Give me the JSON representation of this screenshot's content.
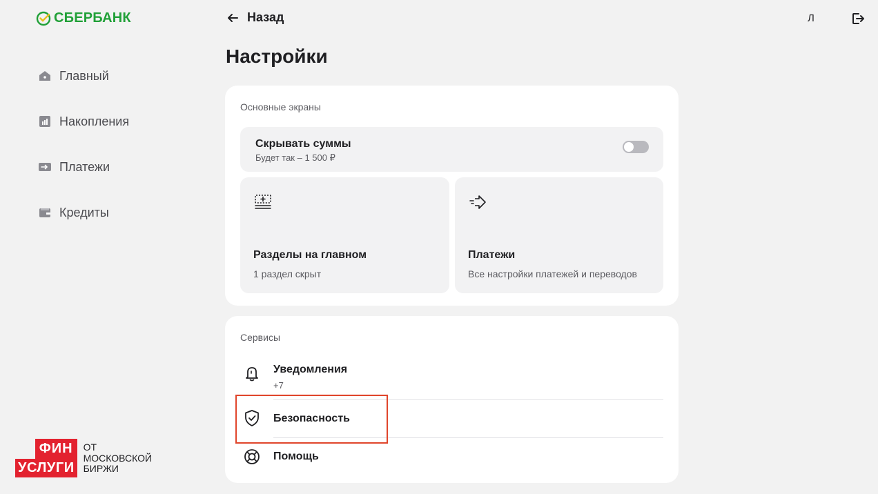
{
  "brand": {
    "name": "СБЕРБАНК",
    "color": "#21a038"
  },
  "sidebar": {
    "items": [
      {
        "label": "Главный",
        "icon": "home-icon"
      },
      {
        "label": "Накопления",
        "icon": "chart-icon"
      },
      {
        "label": "Платежи",
        "icon": "transfer-icon"
      },
      {
        "label": "Кредиты",
        "icon": "wallet-icon"
      }
    ]
  },
  "header": {
    "back_label": "Назад",
    "user_initial": "Л",
    "logout_icon": "logout-icon"
  },
  "page": {
    "title": "Настройки"
  },
  "main_screens": {
    "title": "Основные экраны",
    "hide_amounts": {
      "label": "Скрывать суммы",
      "hint": "Будет так – 1 500 ₽",
      "enabled": false
    },
    "tiles": [
      {
        "title": "Разделы на главном",
        "subtitle": "1 раздел скрыт",
        "icon": "sections-icon"
      },
      {
        "title": "Платежи",
        "subtitle": "Все настройки платежей и переводов",
        "icon": "payments-arrow-icon"
      }
    ]
  },
  "services": {
    "title": "Сервисы",
    "items": [
      {
        "label": "Уведомления",
        "sub": "+7",
        "icon": "bell-icon"
      },
      {
        "label": "Безопасность",
        "icon": "shield-check-icon"
      },
      {
        "label": "Помощь",
        "icon": "lifebuoy-icon"
      }
    ]
  },
  "footer_badge": {
    "line1": "ФИН",
    "line2": "УСЛУГИ",
    "caption1": "ОТ",
    "caption2": "МОСКОВСКОЙ",
    "caption3": "БИРЖИ",
    "color": "#e3222f"
  },
  "highlight_color": "#e0452b"
}
